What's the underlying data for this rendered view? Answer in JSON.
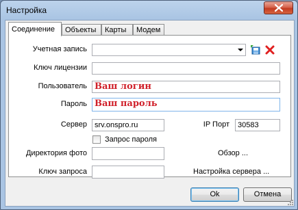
{
  "window": {
    "title": "Настройка"
  },
  "tabs": [
    "Соединение",
    "Объекты",
    "Карты",
    "Модем"
  ],
  "form": {
    "account_label": "Учетная запись",
    "license_label": "Ключ лицензии",
    "user_label": "Пользователь",
    "user_overlay": "Ваш логин",
    "password_label": "Пароль",
    "password_overlay": "Ваш пароль",
    "server_label": "Сервер",
    "server_value": "srv.onspro.ru",
    "port_label": "IP Порт",
    "port_value": "30583",
    "save_password_label": "Запрос пароля",
    "photo_dir_label": "Директория  фото",
    "browse_label": "Обзор ...",
    "request_key_label": "Ключ запроса",
    "server_settings_label": "Настройка сервера ..."
  },
  "buttons": {
    "ok": "Ok",
    "cancel": "Отмена"
  },
  "icons": {
    "close": "close-icon",
    "save": "save-disk-icon",
    "delete": "delete-x-icon",
    "dropdown": "chevron-down-icon"
  },
  "colors": {
    "title_bar": "#a9c4e3",
    "close_button": "#c23b22",
    "overlay_text": "#d0202a"
  }
}
